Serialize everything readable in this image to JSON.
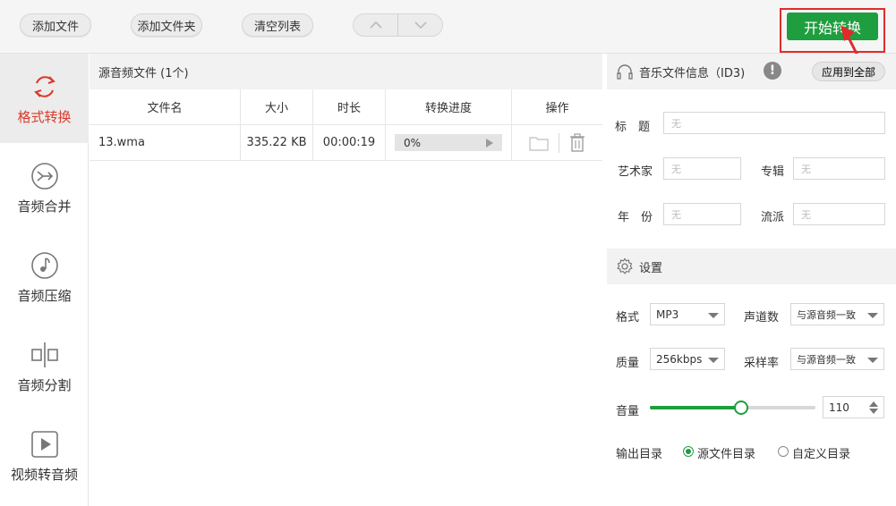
{
  "toolbar": {
    "add_file": "添加文件",
    "add_folder": "添加文件夹",
    "clear_list": "清空列表",
    "start": "开始转换"
  },
  "sidebar": {
    "items": [
      {
        "label": "格式转换",
        "icon": "refresh-icon",
        "active": true
      },
      {
        "label": "音频合并",
        "icon": "merge-icon"
      },
      {
        "label": "音频压缩",
        "icon": "music-note-icon"
      },
      {
        "label": "音频分割",
        "icon": "split-icon"
      },
      {
        "label": "视频转音频",
        "icon": "play-icon"
      }
    ]
  },
  "file_list": {
    "title": "源音频文件 (1个)",
    "columns": [
      "文件名",
      "大小",
      "时长",
      "转换进度",
      "操作"
    ],
    "rows": [
      {
        "name": "13.wma",
        "size": "335.22 KB",
        "duration": "00:00:19",
        "progress_text": "0%",
        "progress": 0
      }
    ]
  },
  "id3": {
    "title": "音乐文件信息（ID3)",
    "apply_all": "应用到全部",
    "fields": {
      "title_label": "标　题",
      "artist_label": "艺术家",
      "album_label": "专辑",
      "year_label": "年　份",
      "genre_label": "流派",
      "placeholder": "无"
    }
  },
  "settings": {
    "title": "设置",
    "format_label": "格式",
    "format_value": "MP3",
    "channels_label": "声道数",
    "channels_value": "与源音频一致",
    "quality_label": "质量",
    "quality_value": "256kbps",
    "samplerate_label": "采样率",
    "samplerate_value": "与源音频一致",
    "volume_label": "音量",
    "volume_value": "110",
    "volume_fraction": 0.55,
    "output_label": "输出目录",
    "output_source": "源文件目录",
    "output_custom": "自定义目录",
    "output_selected": "source"
  },
  "colors": {
    "accent": "#1e9e3e",
    "highlight_red": "#e02b2b",
    "active_text": "#d93b2b"
  }
}
